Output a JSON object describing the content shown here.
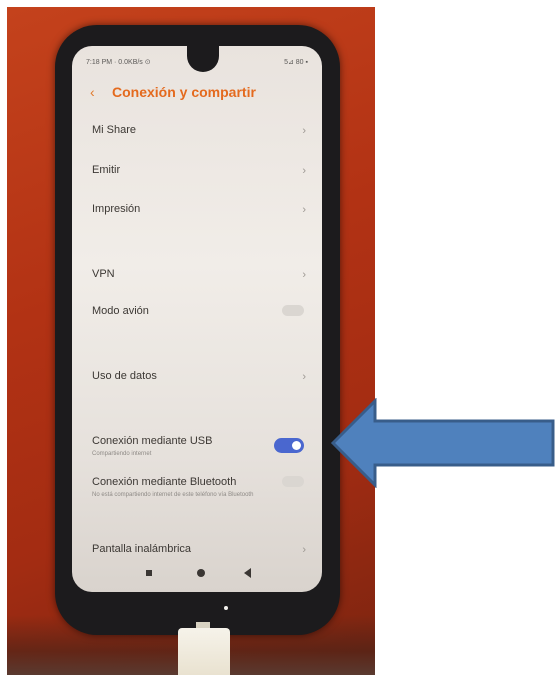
{
  "status_bar": {
    "left": "7:18 PM · 0.0KB/s ⊙",
    "right": "5⊿ 80 ▪"
  },
  "header": {
    "back_icon": "‹",
    "title": "Conexión y compartir"
  },
  "settings": [
    {
      "label": "Mi Share",
      "control": "chevron"
    },
    {
      "label": "Emitir",
      "control": "chevron"
    },
    {
      "label": "Impresión",
      "control": "chevron"
    },
    {
      "label": "VPN",
      "control": "chevron"
    },
    {
      "label": "Modo avión",
      "control": "toggle-off"
    },
    {
      "label": "Uso de datos",
      "control": "chevron"
    },
    {
      "label": "Conexión mediante USB",
      "sublabel": "Compartiendo internet",
      "control": "toggle-on"
    },
    {
      "label": "Conexión mediante Bluetooth",
      "sublabel": "No está compartiendo internet de este teléfono vía Bluetooth",
      "control": "toggle-off"
    },
    {
      "label": "Pantalla inalámbrica",
      "control": "chevron"
    }
  ],
  "chevron_glyph": "›",
  "colors": {
    "title_accent": "#e46a1e",
    "toggle_on": "#4a67cf",
    "arrow_fill": "#4f81bd",
    "arrow_stroke": "#385d8a",
    "background_surface": "#b23214"
  },
  "annotation": {
    "shape": "left-pointing-block-arrow",
    "points_to": "Conexión mediante USB"
  }
}
